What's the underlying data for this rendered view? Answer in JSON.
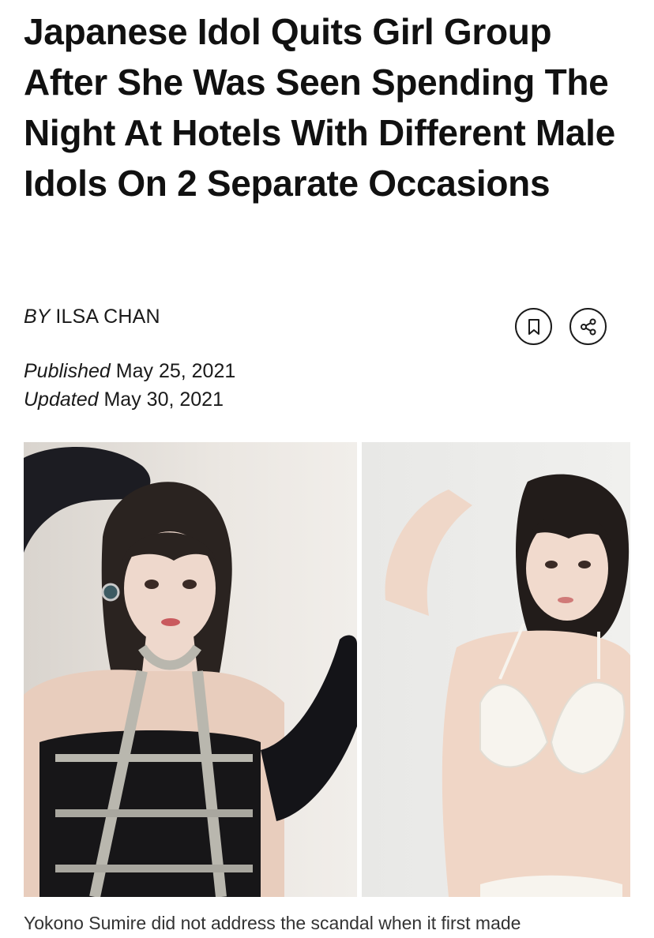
{
  "article": {
    "headline": "Japanese Idol Quits Girl Group After She Was Seen Spending The Night At Hotels With Different Male Idols On 2 Separate Occasions",
    "byline": {
      "prefix": "BY",
      "author": "ILSA CHAN"
    },
    "dates": {
      "published_label": "Published",
      "published_value": "May 25, 2021",
      "updated_label": "Updated",
      "updated_value": "May 30, 2021"
    },
    "actions": {
      "bookmark_icon": "bookmark-icon",
      "share_icon": "share-icon"
    },
    "images": [
      {
        "name": "photo-left",
        "description_icon": "idol-photo-black-outfit"
      },
      {
        "name": "photo-right",
        "description_icon": "idol-photo-white-bikini"
      }
    ],
    "caption": "Yokono Sumire did not address the scandal when it first made"
  },
  "colors": {
    "text": "#111111",
    "caption_text": "#333333",
    "icon_border": "#1a1a1a"
  }
}
